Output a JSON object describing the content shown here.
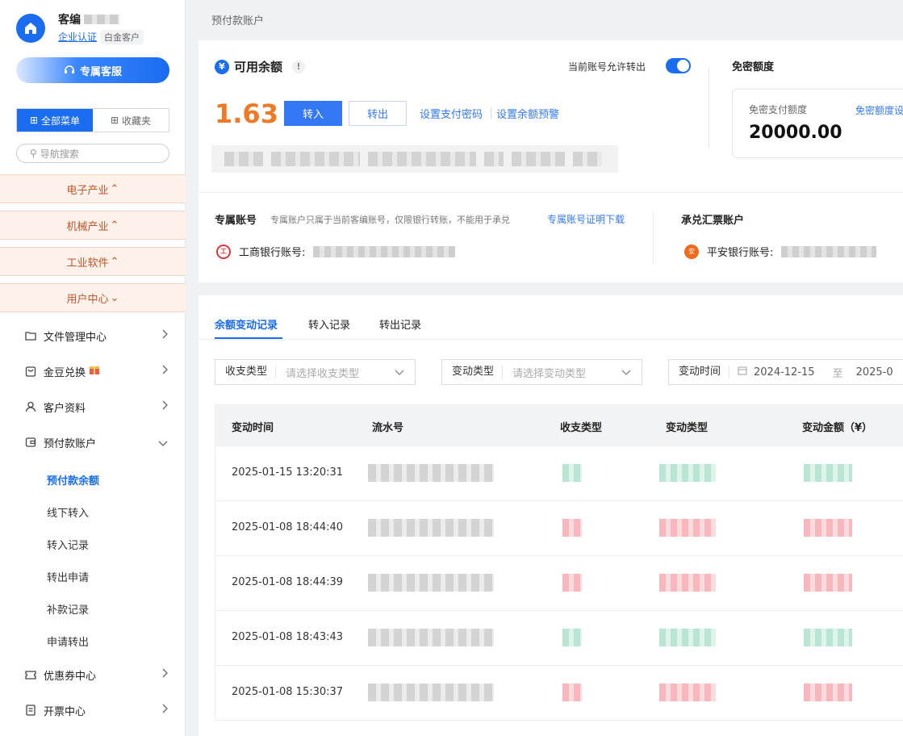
{
  "user": {
    "name": "客编",
    "certify": "企业认证",
    "level": "白金客户"
  },
  "sidebar": {
    "service_button": "专属客服",
    "tab_all": "全部菜单",
    "tab_fav": "收藏夹",
    "search_placeholder": "导航搜索",
    "categories": [
      {
        "label": "电子产业",
        "arrow": "^"
      },
      {
        "label": "机械产业",
        "arrow": "^"
      },
      {
        "label": "工业软件",
        "arrow": "^"
      },
      {
        "label": "用户中心",
        "arrow": "v"
      }
    ],
    "items": [
      {
        "label": "文件管理中心"
      },
      {
        "label": "金豆兑换"
      },
      {
        "label": "客户资料"
      },
      {
        "label": "预付款账户"
      },
      {
        "label": "优惠券中心"
      },
      {
        "label": "开票中心"
      }
    ],
    "sub_items": [
      {
        "label": "预付款余额",
        "active": true
      },
      {
        "label": "线下转入"
      },
      {
        "label": "转入记录"
      },
      {
        "label": "转出申请"
      },
      {
        "label": "补款记录"
      },
      {
        "label": "申请转出"
      }
    ]
  },
  "breadcrumb": "预付款账户",
  "balance": {
    "title": "可用余额",
    "currency_icon": "¥",
    "amount": "1.63",
    "transfer_in": "转入",
    "transfer_out": "转出",
    "set_password": "设置支付密码",
    "set_alert": "设置余额预警",
    "allow_transfer_label": "当前账号允许转出",
    "allow_transfer_on": true
  },
  "free_pay": {
    "title": "免密额度",
    "label": "免密支付额度",
    "link": "免密额度设",
    "amount": "20000.00"
  },
  "accounts": {
    "dedicated_title": "专属账号",
    "dedicated_note": "专属账户只属于当前客编账号，仅限银行转账，不能用于承兑",
    "dedicated_link": "专属账号证明下载",
    "icbc_label": "工商银行账号:",
    "acceptance_title": "承兑汇票账户",
    "pingan_label": "平安银行账号:"
  },
  "records": {
    "tabs": [
      "余额变动记录",
      "转入记录",
      "转出记录"
    ],
    "active_tab": 0,
    "filters": {
      "income_type_label": "收支类型",
      "income_type_placeholder": "请选择收支类型",
      "change_type_label": "变动类型",
      "change_type_placeholder": "请选择变动类型",
      "change_time_label": "变动时间",
      "date_from": "2024-12-15",
      "date_sep": "至",
      "date_to": "2025-0"
    },
    "columns": [
      "变动时间",
      "流水号",
      "收支类型",
      "变动类型",
      "变动金额（¥）"
    ],
    "rows": [
      {
        "time": "2025-01-15 13:20:31",
        "tone": "g"
      },
      {
        "time": "2025-01-08 18:44:40",
        "tone": "r"
      },
      {
        "time": "2025-01-08 18:44:39",
        "tone": "r"
      },
      {
        "time": "2025-01-08 18:43:43",
        "tone": "g"
      },
      {
        "time": "2025-01-08 15:30:37",
        "tone": "r"
      }
    ]
  },
  "colors": {
    "primary": "#1a6cf0",
    "amount": "#ef7a25",
    "category_bg": "#fdf1ea"
  }
}
